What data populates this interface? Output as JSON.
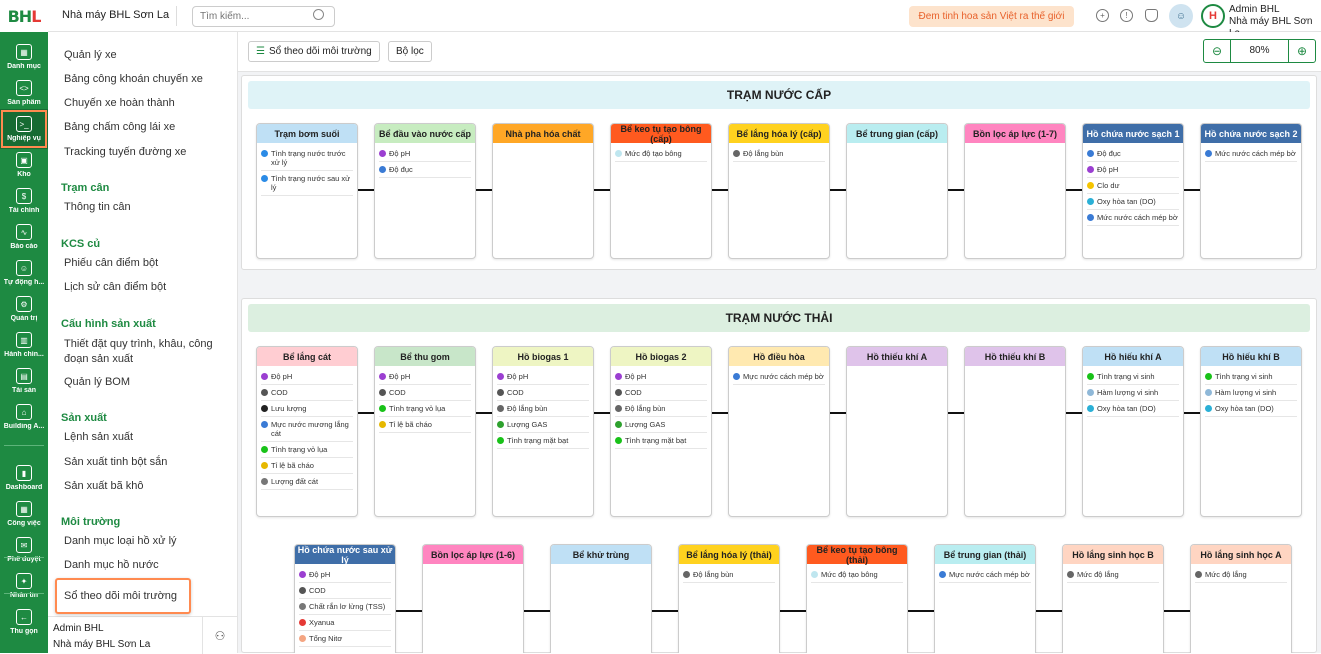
{
  "app": {
    "logo_a": "BH",
    "logo_b": "L",
    "factory": "Nhà máy BHL Sơn La",
    "search_placeholder": "Tìm kiếm...",
    "slogan": "Đem tinh hoa sản Việt ra thế giới",
    "user": "Admin BHL",
    "user_factory": "Nhà máy BHL Sơn La",
    "bot_icon": "robot-icon"
  },
  "rail": [
    {
      "label": "Danh mục",
      "icon": "grid-icon",
      "glyph": "▦"
    },
    {
      "label": "Sản phẩm",
      "icon": "code-box-icon",
      "glyph": "<>"
    },
    {
      "label": "Nghiệp vụ",
      "icon": "terminal-icon",
      "glyph": ">_",
      "active": true
    },
    {
      "label": "Kho",
      "icon": "box-icon",
      "glyph": "▣"
    },
    {
      "label": "Tài chính",
      "icon": "dollar-icon",
      "glyph": "$"
    },
    {
      "label": "Báo cáo",
      "icon": "chart-line-icon",
      "glyph": "∿"
    },
    {
      "label": "Tự động h...",
      "icon": "robot-icon",
      "glyph": "☺"
    },
    {
      "label": "Quản trị",
      "icon": "gear-icon",
      "glyph": "⚙"
    },
    {
      "label": "Hành chín...",
      "icon": "building-icon",
      "glyph": "▥"
    },
    {
      "label": "Tài sản",
      "icon": "calendar-icon",
      "glyph": "▤"
    },
    {
      "label": "Building A...",
      "icon": "bank-icon",
      "glyph": "⌂"
    },
    {
      "label": "Dashboard",
      "icon": "bar-chart-icon",
      "glyph": "▮"
    },
    {
      "label": "Công việc",
      "icon": "apps-icon",
      "glyph": "▦"
    },
    {
      "label": "Phê duyệt",
      "icon": "mail-icon",
      "glyph": "✉"
    },
    {
      "label": "Nhắn tin",
      "icon": "messenger-icon",
      "glyph": "✦"
    },
    {
      "label": "Thu gọn",
      "icon": "arrow-left-icon",
      "glyph": "←"
    }
  ],
  "menu": {
    "items": [
      {
        "type": "item",
        "label": "Quản lý xe"
      },
      {
        "type": "item",
        "label": "Bảng công khoán chuyến xe"
      },
      {
        "type": "item",
        "label": "Chuyến xe hoàn thành"
      },
      {
        "type": "item",
        "label": "Bảng chấm công lái xe"
      },
      {
        "type": "item",
        "label": "Tracking tuyến đường xe"
      },
      {
        "type": "head",
        "label": "Trạm cân"
      },
      {
        "type": "item",
        "label": "Thông tin cân"
      },
      {
        "type": "head",
        "label": "KCS củ"
      },
      {
        "type": "item",
        "label": "Phiếu cân điểm bột"
      },
      {
        "type": "item",
        "label": "Lịch sử cân điểm bột"
      },
      {
        "type": "head",
        "label": "Cấu hình sản xuất"
      },
      {
        "type": "item",
        "label": "Thiết đặt quy trình, khâu, công đoạn sản xuất"
      },
      {
        "type": "item",
        "label": "Quản lý BOM"
      },
      {
        "type": "head",
        "label": "Sản xuất"
      },
      {
        "type": "item",
        "label": "Lệnh sản xuất"
      },
      {
        "type": "item",
        "label": "Sản xuất tinh bột sắn"
      },
      {
        "type": "item",
        "label": "Sản xuất bã khô"
      },
      {
        "type": "head",
        "label": "Môi trường"
      },
      {
        "type": "item",
        "label": "Danh mục loại hồ xử lý"
      },
      {
        "type": "item",
        "label": "Danh mục hồ nước"
      },
      {
        "type": "item",
        "label": "Sổ theo dõi môi trường",
        "selected": true
      }
    ],
    "footer_user": "Admin BHL",
    "footer_factory": "Nhà máy BHL Sơn La",
    "footer_icon": "users-icon"
  },
  "toolbar": {
    "log_label": "Sổ theo dõi môi trường",
    "filter_label": "Bộ lọc",
    "zoom": "80%"
  },
  "sections": [
    {
      "title": "TRẠM NƯỚC CẤP",
      "bg": "#dff3f7",
      "rows": [
        [
          {
            "name": "Trạm bơm suối",
            "color": "#bfe0f5",
            "items": [
              [
                "Tình trạng nước trước xử lý",
                "#2b8be6"
              ],
              [
                "Tình trạng nước sau xử lý",
                "#2b8be6"
              ]
            ]
          },
          {
            "name": "Bể đầu vào nước cấp",
            "color": "#c7ecc0",
            "items": [
              [
                "Độ pH",
                "#9b3fd1"
              ],
              [
                "Độ đục",
                "#3a7bd5"
              ]
            ]
          },
          {
            "name": "Nhà pha hóa chất",
            "color": "#ffa726",
            "items": []
          },
          {
            "name": "Bể keo tụ tạo bông (cấp)",
            "color": "#ff5a1f",
            "items": [
              [
                "Mức độ tạo bông",
                "#bfe6ef"
              ]
            ]
          },
          {
            "name": "Bể lắng hóa lý (cấp)",
            "color": "#ffd21f",
            "items": [
              [
                "Độ lắng bùn",
                "#666666"
              ]
            ]
          },
          {
            "name": "Bể trung gian (cấp)",
            "color": "#b9edf0",
            "items": []
          },
          {
            "name": "Bồn lọc áp lực (1-7)",
            "color": "#ff85c0",
            "items": []
          },
          {
            "name": "Hồ chứa nước sạch 1",
            "color": "#3f6ea8",
            "text": "#ffffff",
            "items": [
              [
                "Độ đục",
                "#3a7bd5"
              ],
              [
                "Độ pH",
                "#9b3fd1"
              ],
              [
                "Clo dư",
                "#f5c400"
              ],
              [
                "Oxy hòa tan (DO)",
                "#2bb0d6"
              ],
              [
                "Mức nước cách mép bờ",
                "#3a7bd5"
              ]
            ]
          },
          {
            "name": "Hồ chứa nước sạch 2",
            "color": "#3f6ea8",
            "text": "#ffffff",
            "items": [
              [
                "Mức nước cách mép bờ",
                "#3a7bd5"
              ]
            ]
          }
        ]
      ]
    },
    {
      "title": "TRẠM NƯỚC THẢI",
      "bg": "#dcefe0",
      "rows": [
        [
          {
            "name": "Bể lắng cát",
            "color": "#ffcdd2",
            "items": [
              [
                "Độ pH",
                "#9b3fd1"
              ],
              [
                "COD",
                "#555555"
              ],
              [
                "Lưu lượng",
                "#222222"
              ],
              [
                "Mực nước mương lắng cát",
                "#3a7bd5"
              ],
              [
                "Tình trạng vỏ lụa",
                "#19c219"
              ],
              [
                "Tỉ lệ bã cháo",
                "#e6b800"
              ],
              [
                "Lượng đất cát",
                "#777777"
              ]
            ]
          },
          {
            "name": "Bể thu gom",
            "color": "#c8e6c9",
            "items": [
              [
                "Độ pH",
                "#9b3fd1"
              ],
              [
                "COD",
                "#555555"
              ],
              [
                "Tình trạng vỏ lụa",
                "#19c219"
              ],
              [
                "Tỉ lệ bã cháo",
                "#e6b800"
              ]
            ]
          },
          {
            "name": "Hồ biogas 1",
            "color": "#eef5c3",
            "items": [
              [
                "Độ pH",
                "#9b3fd1"
              ],
              [
                "COD",
                "#555555"
              ],
              [
                "Độ lắng bùn",
                "#666666"
              ],
              [
                "Lượng GAS",
                "#2ea12e"
              ],
              [
                "Tình trạng mặt bạt",
                "#19c219"
              ]
            ]
          },
          {
            "name": "Hồ biogas 2",
            "color": "#eef5c3",
            "items": [
              [
                "Độ pH",
                "#9b3fd1"
              ],
              [
                "COD",
                "#555555"
              ],
              [
                "Độ lắng bùn",
                "#666666"
              ],
              [
                "Lượng GAS",
                "#2ea12e"
              ],
              [
                "Tình trạng mặt bạt",
                "#19c219"
              ]
            ]
          },
          {
            "name": "Hồ điều hòa",
            "color": "#ffe9b0",
            "items": [
              [
                "Mực nước cách mép bờ",
                "#3a7bd5"
              ]
            ]
          },
          {
            "name": "Hồ thiếu khí A",
            "color": "#dfc3ea",
            "items": []
          },
          {
            "name": "Hồ thiếu khí B",
            "color": "#dfc3ea",
            "items": []
          },
          {
            "name": "Hồ hiếu khí A",
            "color": "#bfe0f5",
            "items": [
              [
                "Tình trạng vi sinh",
                "#19c219"
              ],
              [
                "Hàm lượng vi sinh",
                "#8fb8d8"
              ],
              [
                "Oxy hòa tan (DO)",
                "#2bb0d6"
              ]
            ]
          },
          {
            "name": "Hồ hiếu khí B",
            "color": "#bfe0f5",
            "items": [
              [
                "Tình trạng vi sinh",
                "#19c219"
              ],
              [
                "Hàm lượng vi sinh",
                "#8fb8d8"
              ],
              [
                "Oxy hòa tan (DO)",
                "#2bb0d6"
              ]
            ]
          }
        ],
        [
          {
            "name": "Hồ chứa nước sau xử lý",
            "color": "#3f6ea8",
            "text": "#ffffff",
            "items": [
              [
                "Độ pH",
                "#9b3fd1"
              ],
              [
                "COD",
                "#555555"
              ],
              [
                "Chất rắn lơ lửng (TSS)",
                "#777777"
              ],
              [
                "Xyanua",
                "#e53935"
              ],
              [
                "Tổng Nitơ",
                "#f4a582"
              ]
            ]
          },
          {
            "name": "Bồn lọc áp lực (1-6)",
            "color": "#ff85c0",
            "items": []
          },
          {
            "name": "Bể khử trùng",
            "color": "#bfe0f5",
            "items": []
          },
          {
            "name": "Bể lắng hóa lý (thải)",
            "color": "#ffd21f",
            "items": [
              [
                "Độ lắng bùn",
                "#666666"
              ]
            ]
          },
          {
            "name": "Bể keo tụ tạo bông (thải)",
            "color": "#ff5a1f",
            "items": [
              [
                "Mức độ tạo bông",
                "#bfe6ef"
              ]
            ]
          },
          {
            "name": "Bể trung gian (thải)",
            "color": "#b9edf0",
            "items": [
              [
                "Mực nước cách mép bờ",
                "#3a7bd5"
              ]
            ]
          },
          {
            "name": "Hồ lắng sinh học B",
            "color": "#ffd5c2",
            "items": [
              [
                "Mức độ lắng",
                "#666666"
              ]
            ]
          },
          {
            "name": "Hồ lắng sinh học A",
            "color": "#ffd5c2",
            "items": [
              [
                "Mức độ lắng",
                "#666666"
              ]
            ]
          }
        ]
      ]
    }
  ]
}
